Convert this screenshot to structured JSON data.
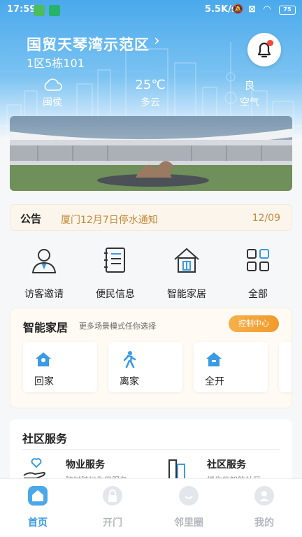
{
  "status_bar": {
    "time": "17:59",
    "speed": "5.5K/s",
    "battery": "75"
  },
  "header": {
    "community": "国贸天琴湾示范区",
    "unit": "1区5栋101"
  },
  "weather": {
    "city": "闽侯",
    "temperature": "25℃",
    "condition": "多云",
    "air_quality": "良",
    "air_label": "空气"
  },
  "notice": {
    "tag": "公告",
    "text": "厦门12月7日停水通知",
    "date": "12/09"
  },
  "quick_actions": [
    {
      "label": "访客邀请",
      "icon": "visitor-icon"
    },
    {
      "label": "便民信息",
      "icon": "notebook-icon"
    },
    {
      "label": "智能家居",
      "icon": "house-icon"
    },
    {
      "label": "全部",
      "icon": "grid-icon"
    }
  ],
  "smart_home": {
    "title": "智能家居",
    "subtitle": "更多场景模式任你选择",
    "control_label": "控制中心",
    "scenes": [
      {
        "label": "回家",
        "icon": "home-scene-icon"
      },
      {
        "label": "离家",
        "icon": "walking-person-icon"
      },
      {
        "label": "全开",
        "icon": "all-on-icon"
      }
    ]
  },
  "community_services": {
    "title": "社区服务",
    "items": [
      {
        "name": "物业服务",
        "desc": "随时随地为您服务",
        "icon": "heart-hand-icon"
      },
      {
        "name": "社区服务",
        "desc": "楼你的智能社区",
        "icon": "building-icon"
      }
    ]
  },
  "tabbar": [
    {
      "label": "首页",
      "icon": "home-tab-icon",
      "active": true
    },
    {
      "label": "开门",
      "icon": "lock-icon",
      "active": false
    },
    {
      "label": "邻里圈",
      "icon": "chat-icon",
      "active": false
    },
    {
      "label": "我的",
      "icon": "profile-icon",
      "active": false
    }
  ],
  "colors": {
    "primary": "#4aa8ea",
    "accent": "#f19a2b",
    "notice_text": "#c58a3a",
    "alert": "#f04b3a"
  }
}
